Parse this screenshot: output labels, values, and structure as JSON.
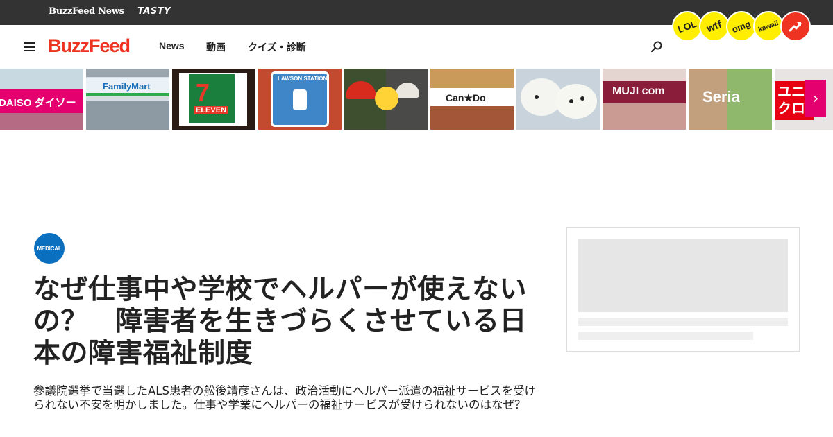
{
  "network_bar": {
    "brand_news": "BuzzFeed News",
    "brand_tasty": "TASTY"
  },
  "nav": {
    "logo": "BuzzFeed",
    "links": [
      "News",
      "動画",
      "クイズ・診断"
    ],
    "badges": [
      "LOL",
      "wtf",
      "omg",
      "kawaii"
    ],
    "trending_icon": "trending-arrow-icon",
    "search_icon": "search-icon",
    "menu_icon": "hamburger-menu-icon"
  },
  "thumbnails": [
    {
      "label": "DAISO ダイソー",
      "icon": "daiso-store-photo"
    },
    {
      "label": "FamilyMart",
      "icon": "familymart-store-photo"
    },
    {
      "label": "ELEVEN",
      "icon": "seven-eleven-sign-photo"
    },
    {
      "label": "LAWSON STATION",
      "icon": "lawson-sign-photo"
    },
    {
      "label": "",
      "icon": "mushroom-thinking-emoji-photo"
    },
    {
      "label": "Can★Do",
      "icon": "cando-store-photo"
    },
    {
      "label": "",
      "icon": "mochi-dessert-photo"
    },
    {
      "label": "MUJI com",
      "icon": "muji-store-photo"
    },
    {
      "label": "Seria",
      "icon": "seria-store-photo"
    },
    {
      "label": "ユニクロ",
      "icon": "uniqlo-sign-photo"
    }
  ],
  "thumb_next_icon": "chevron-right-icon",
  "article": {
    "category": "MEDICAL",
    "headline": "なぜ仕事中や学校でヘルパーが使えないの？　障害者を生きづらくさせている日本の障害福祉制度",
    "dek": "参議院選挙で当選したALS患者の舩後靖彦さんは、政治活動にヘルパー派遣の福祉サービスを受けられない不安を明かしました。仕事や学業にヘルパーの福祉サービスが受けられないのはなぜ？"
  },
  "colors": {
    "brand_red": "#ee3322",
    "network_bar": "#333333",
    "badge_yellow": "#ffee00",
    "medical_blue": "#0b6fbf",
    "skeleton": "#e6e6e6"
  }
}
